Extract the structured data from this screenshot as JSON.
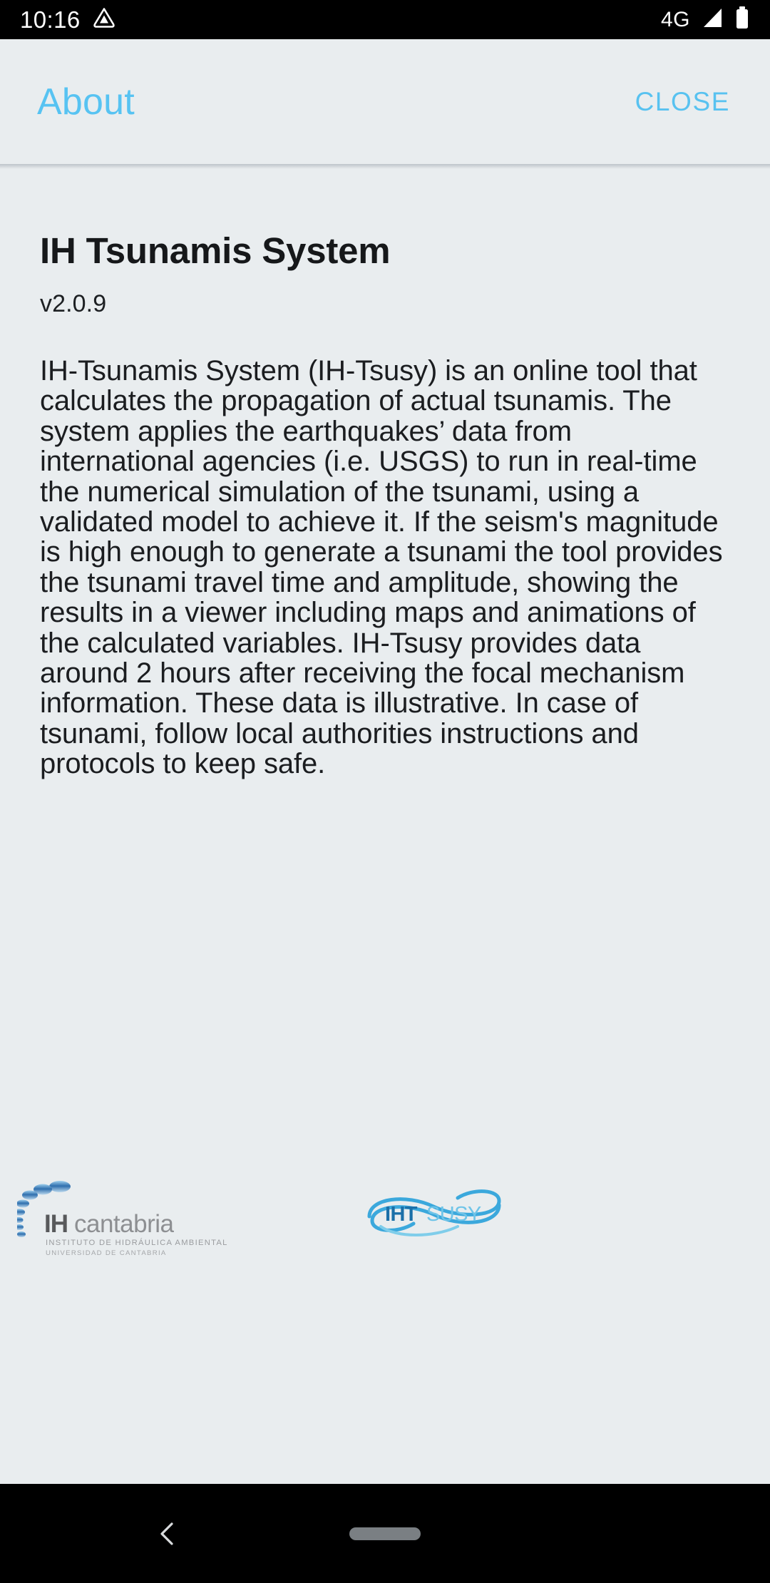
{
  "status_bar": {
    "time": "10:16",
    "notification_icon": "triangle-badge-icon",
    "network_label": "4G",
    "signal_icon": "signal-bars-icon",
    "battery_icon": "battery-icon"
  },
  "app_bar": {
    "title": "About",
    "close_label": "CLOSE",
    "title_color": "#57c3f2",
    "close_color": "#58c2f0",
    "background_color": "#e9edef"
  },
  "content": {
    "app_title": "IH Tsunamis System",
    "version": "v2.0.9",
    "description": "IH-Tsunamis System (IH-Tsusy) is an online tool that calculates the propagation of actual tsunamis. The system applies the earthquakes’ data from international agencies (i.e. USGS) to run in real-time the numerical simulation of the tsunami, using a validated model to achieve it. If the seism's magnitude is high enough to generate a tsunami the tool provides the tsunami travel time and amplitude, showing the results in a viewer including maps and animations of the calculated variables. IH-Tsusy provides data around 2 hours after receiving the focal mechanism information. These data is illustrative. In case of tsunami, follow local authorities instructions and protocols to keep safe.",
    "text_color": "#1b1d20"
  },
  "logos": {
    "ih_cantabria": {
      "name": "ih-cantabria-logo",
      "word_bold": "IH",
      "word_light": "cantabria",
      "tagline_1": "INSTITUTO DE HIDRÁULICA AMBIENTAL",
      "tagline_2": "UNIVERSIDAD DE CANTABRIA",
      "bold_color": "#58595b",
      "light_color": "#8d8f92",
      "dot_color": "#2f6fae"
    },
    "ihtsusy": {
      "name": "ihtsusy-logo",
      "word_bold": "IHT",
      "word_light": "SUSY",
      "bold_color": "#1b6fa8",
      "light_color": "#6fc4e8",
      "swirl_color": "#3ba8dc"
    }
  },
  "nav_bar": {
    "back_icon": "chevron-left-icon",
    "home_pill": "home-pill-indicator",
    "background_color": "#000000"
  }
}
